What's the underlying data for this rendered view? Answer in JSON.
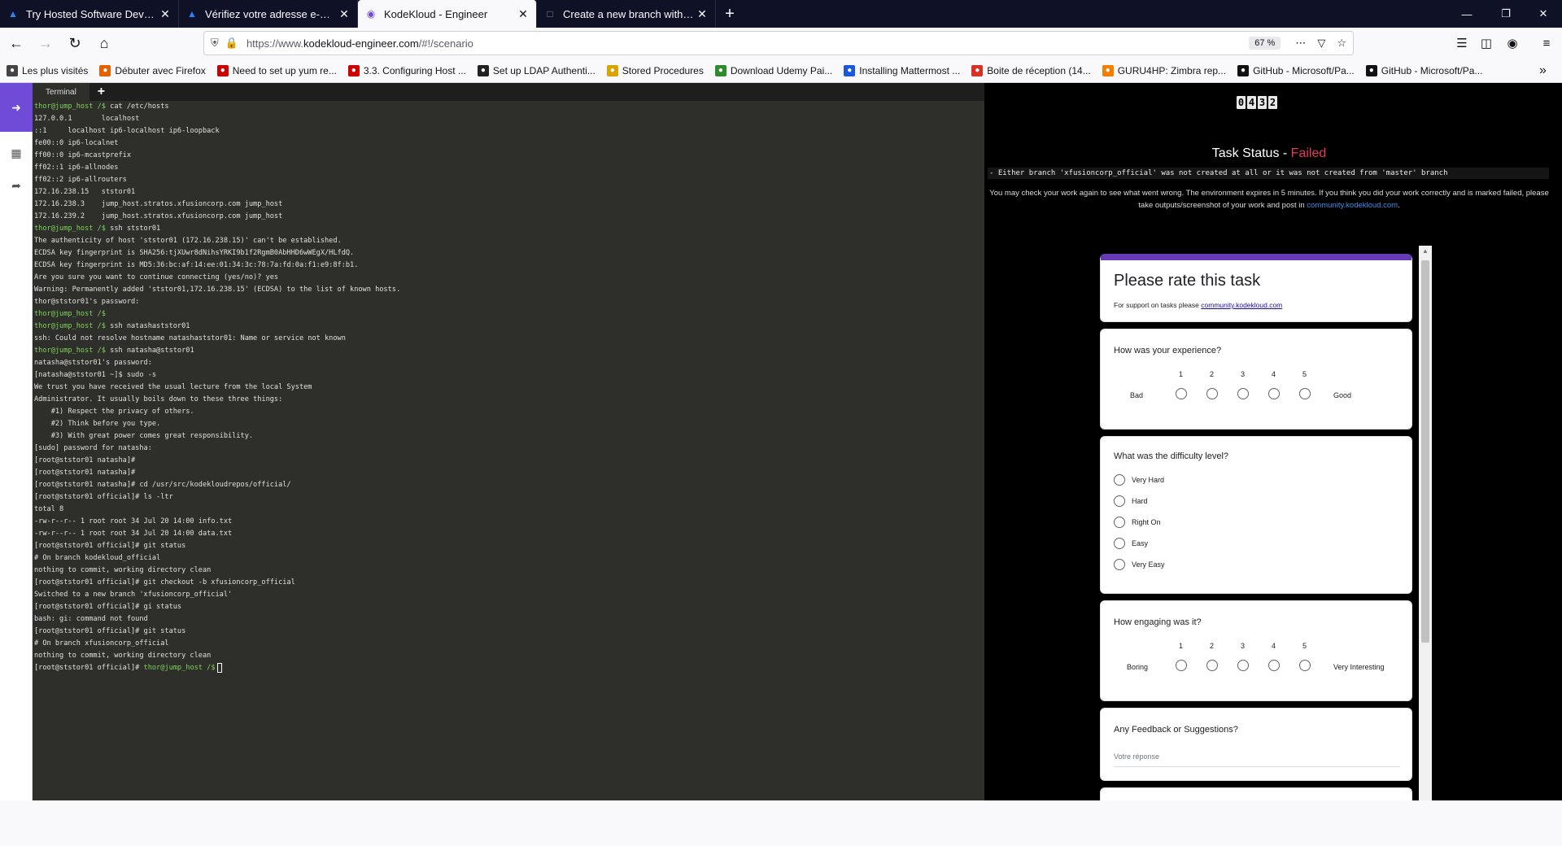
{
  "browser": {
    "tabs": [
      {
        "title": "Try Hosted Software Developm",
        "icon": "atlassian-icon",
        "color": "#2684ff"
      },
      {
        "title": "Vérifiez votre adresse e-mail - S",
        "icon": "atlassian-icon",
        "color": "#2684ff"
      },
      {
        "title": "KodeKloud - Engineer",
        "icon": "kodekloud-icon",
        "color": "#6f4bd8",
        "active": true
      },
      {
        "title": "Create a new branch with git ar",
        "icon": "generic-page-icon",
        "color": "#888"
      }
    ],
    "url_prefix": "https://www.",
    "url_host": "kodekloud-engineer.com",
    "url_path": "/#!/scenario",
    "zoom": "67 %",
    "bookmarks": [
      {
        "label": "Les plus visités",
        "icon": "gear-icon",
        "color": "#444"
      },
      {
        "label": "Débuter avec Firefox",
        "icon": "firefox-icon",
        "color": "#e66000"
      },
      {
        "label": "Need to set up yum re...",
        "icon": "redhat-icon",
        "color": "#cc0000"
      },
      {
        "label": "3.3. Configuring Host ...",
        "icon": "redhat-icon",
        "color": "#cc0000"
      },
      {
        "label": "Set up LDAP Authenti...",
        "icon": "bookmark-icon",
        "color": "#222"
      },
      {
        "label": "Stored Procedures",
        "icon": "bookmark-icon",
        "color": "#d9a400"
      },
      {
        "label": "Download Udemy Pai...",
        "icon": "ftu-icon",
        "color": "#2e8b2e"
      },
      {
        "label": "Installing Mattermost ...",
        "icon": "mattermost-icon",
        "color": "#1c58d9"
      },
      {
        "label": "Boite de réception (14...",
        "icon": "gmail-icon",
        "color": "#d93025"
      },
      {
        "label": "GURU4HP: Zimbra rep...",
        "icon": "blogger-icon",
        "color": "#f57d00"
      },
      {
        "label": "GitHub - Microsoft/Pa...",
        "icon": "github-icon",
        "color": "#111"
      },
      {
        "label": "GitHub - Microsoft/Pa...",
        "icon": "github-icon",
        "color": "#111"
      }
    ]
  },
  "terminal": {
    "tab_label": "Terminal",
    "lines": [
      {
        "p": "thor@jump_host /$ ",
        "t": "cat /etc/hosts"
      },
      {
        "t": "127.0.0.1       localhost"
      },
      {
        "t": "::1     localhost ip6-localhost ip6-loopback"
      },
      {
        "t": "fe00::0 ip6-localnet"
      },
      {
        "t": "ff00::0 ip6-mcastprefix"
      },
      {
        "t": "ff02::1 ip6-allnodes"
      },
      {
        "t": "ff02::2 ip6-allrouters"
      },
      {
        "t": "172.16.238.15   ststor01"
      },
      {
        "t": "172.16.238.3    jump_host.stratos.xfusioncorp.com jump_host"
      },
      {
        "t": "172.16.239.2    jump_host.stratos.xfusioncorp.com jump_host"
      },
      {
        "p": "thor@jump_host /$ ",
        "t": "ssh ststor01"
      },
      {
        "t": "The authenticity of host 'ststor01 (172.16.238.15)' can't be established."
      },
      {
        "t": "ECDSA key fingerprint is SHA256:tjXUwr8dNihsYRKI9b1f2RgmB0AbHHD6wWEgX/HLfdQ."
      },
      {
        "t": "ECDSA key fingerprint is MD5:36:bc:af:14:ee:01:34:3c:78:7a:fd:0a:f1:e9:8f:b1."
      },
      {
        "t": "Are you sure you want to continue connecting (yes/no)? yes"
      },
      {
        "t": "Warning: Permanently added 'ststor01,172.16.238.15' (ECDSA) to the list of known hosts."
      },
      {
        "t": "thor@ststor01's password:"
      },
      {
        "t": ""
      },
      {
        "p": "thor@jump_host /$",
        "t": ""
      },
      {
        "p": "thor@jump_host /$ ",
        "t": "ssh natashaststor01"
      },
      {
        "t": "ssh: Could not resolve hostname natashaststor01: Name or service not known"
      },
      {
        "p": "thor@jump_host /$ ",
        "t": "ssh natasha@ststor01"
      },
      {
        "t": "natasha@ststor01's password:"
      },
      {
        "t": "[natasha@ststor01 ~]$ sudo -s"
      },
      {
        "t": ""
      },
      {
        "t": "We trust you have received the usual lecture from the local System"
      },
      {
        "t": "Administrator. It usually boils down to these three things:"
      },
      {
        "t": ""
      },
      {
        "t": "    #1) Respect the privacy of others."
      },
      {
        "t": "    #2) Think before you type."
      },
      {
        "t": "    #3) With great power comes great responsibility."
      },
      {
        "t": ""
      },
      {
        "t": "[sudo] password for natasha:"
      },
      {
        "t": "[root@ststor01 natasha]#"
      },
      {
        "t": "[root@ststor01 natasha]#"
      },
      {
        "t": "[root@ststor01 natasha]# cd /usr/src/kodekloudrepos/official/"
      },
      {
        "t": "[root@ststor01 official]# ls -ltr"
      },
      {
        "t": "total 8"
      },
      {
        "t": "-rw-r--r-- 1 root root 34 Jul 20 14:00 info.txt"
      },
      {
        "t": "-rw-r--r-- 1 root root 34 Jul 20 14:00 data.txt"
      },
      {
        "t": "[root@ststor01 official]# git status"
      },
      {
        "t": "# On branch kodekloud_official"
      },
      {
        "t": "nothing to commit, working directory clean"
      },
      {
        "t": "[root@ststor01 official]# git checkout -b xfusioncorp_official"
      },
      {
        "t": "Switched to a new branch 'xfusioncorp_official'"
      },
      {
        "t": "[root@ststor01 official]# gi status"
      },
      {
        "t": "bash: gi: command not found"
      },
      {
        "t": "[root@ststor01 official]# git status"
      },
      {
        "t": "# On branch xfusioncorp_official"
      },
      {
        "t": "nothing to commit, working directory clean"
      },
      {
        "t": "[root@ststor01 official]# ",
        "p2": "thor@jump_host /$",
        "cursor": true
      }
    ]
  },
  "task": {
    "timer_digits": [
      "0",
      "4",
      "3",
      "2"
    ],
    "status_prefix": "Task Status - ",
    "status_value": "Failed",
    "error": "- Either branch 'xfusioncorp_official' was not created at all or it was not created from 'master' branch",
    "note_text": "You may check your work again to see what went wrong. The environment expires in 5 minutes. If you think you did your work correctly and is marked failed, please take outputs/screenshot of your work and post in ",
    "note_link": "community.kodekloud.com",
    "note_end": "."
  },
  "form": {
    "title": "Please rate this task",
    "support_text": "For support on tasks please ",
    "support_link": "community.kodekloud.com",
    "q1": {
      "label": "How was your experience?",
      "scale": [
        "1",
        "2",
        "3",
        "4",
        "5"
      ],
      "low": "Bad",
      "high": "Good"
    },
    "q2": {
      "label": "What was the difficulty level?",
      "options": [
        "Very Hard",
        "Hard",
        "Right On",
        "Easy",
        "Very Easy"
      ]
    },
    "q3": {
      "label": "How engaging was it?",
      "scale": [
        "1",
        "2",
        "3",
        "4",
        "5"
      ],
      "low": "Boring",
      "high": "Very Interesting"
    },
    "q4": {
      "label": "Any Feedback or Suggestions?",
      "placeholder": "Votre réponse"
    },
    "accent": "#673ab7"
  }
}
